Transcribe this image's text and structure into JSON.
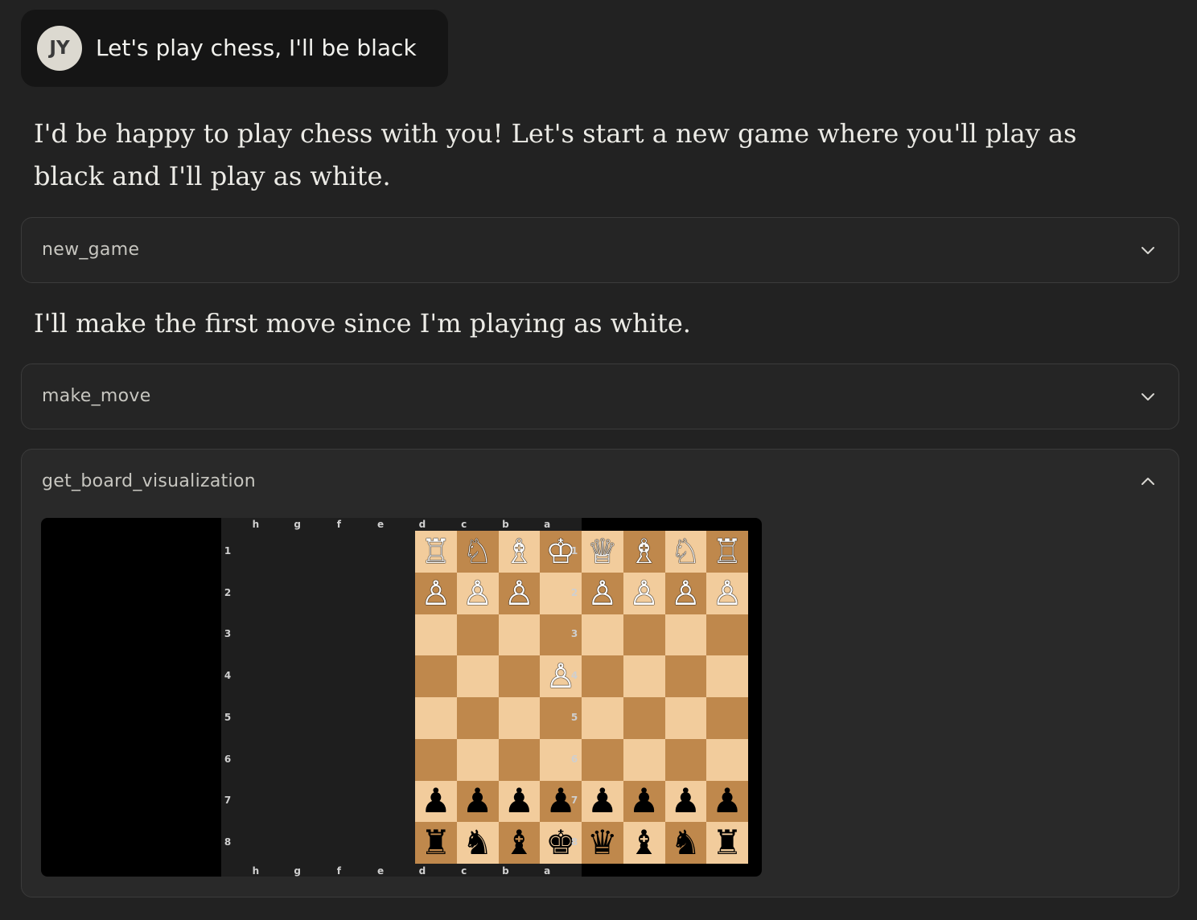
{
  "user_message": {
    "avatar_initials": "JY",
    "text": "Let's play chess, I'll be black"
  },
  "assistant": {
    "paragraph1": "I'd be happy to play chess with you! Let's start a new game where you'll play as black and I'll play as white.",
    "paragraph2": "I'll make the first move since I'm playing as white."
  },
  "tool_calls": [
    {
      "name": "new_game",
      "expanded": false,
      "chevron": "chevron-down-icon"
    },
    {
      "name": "make_move",
      "expanded": false,
      "chevron": "chevron-down-icon"
    },
    {
      "name": "get_board_visualization",
      "expanded": true,
      "chevron": "chevron-up-icon"
    }
  ],
  "board": {
    "files": [
      "h",
      "g",
      "f",
      "e",
      "d",
      "c",
      "b",
      "a"
    ],
    "ranks": [
      "1",
      "2",
      "3",
      "4",
      "5",
      "6",
      "7",
      "8"
    ],
    "rows": [
      [
        "♖",
        "♘",
        "♗",
        "♔",
        "♕",
        "♗",
        "♘",
        "♖"
      ],
      [
        "♙",
        "♙",
        "♙",
        "",
        "♙",
        "♙",
        "♙",
        "♙"
      ],
      [
        "",
        "",
        "",
        "",
        "",
        "",
        "",
        ""
      ],
      [
        "",
        "",
        "",
        "♙",
        "",
        "",
        "",
        ""
      ],
      [
        "",
        "",
        "",
        "",
        "",
        "",
        "",
        ""
      ],
      [
        "",
        "",
        "",
        "",
        "",
        "",
        "",
        ""
      ],
      [
        "♟",
        "♟",
        "♟",
        "♟",
        "♟",
        "♟",
        "♟",
        "♟"
      ],
      [
        "♜",
        "♞",
        "♝",
        "♚",
        "♛",
        "♝",
        "♞",
        "♜"
      ]
    ],
    "colors": {
      "light": "#f2cc9c",
      "dark": "#bf884c"
    }
  }
}
